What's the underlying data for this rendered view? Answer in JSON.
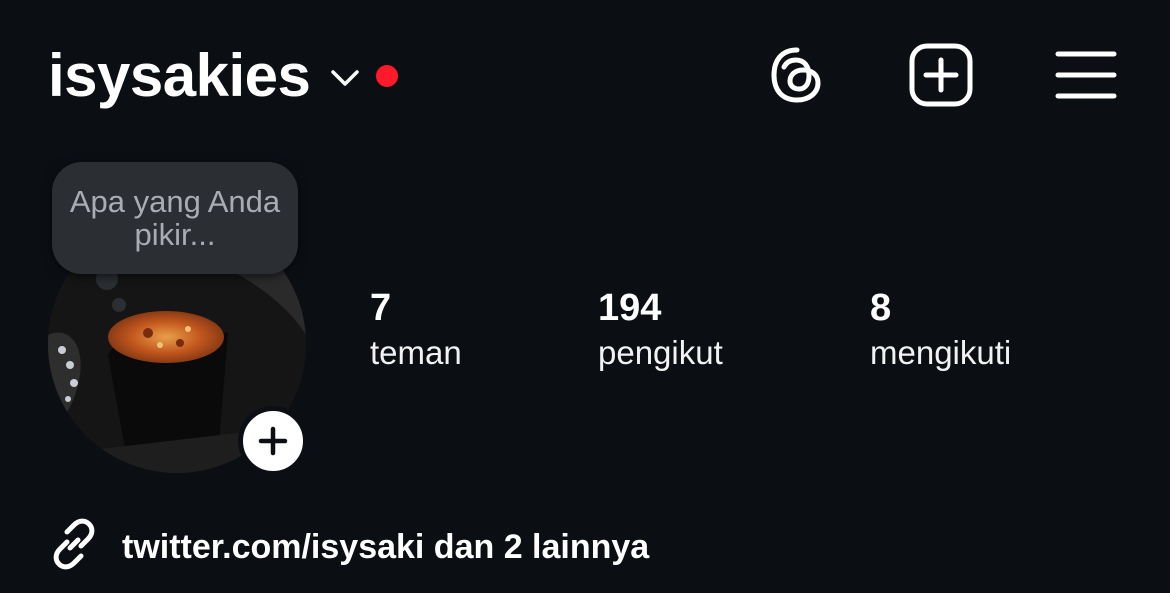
{
  "header": {
    "username": "isysakies",
    "icons": {
      "threads": "threads-icon",
      "create": "add-square-icon",
      "menu": "hamburger-menu-icon"
    },
    "notification_color": "#ff1a2b"
  },
  "note": {
    "placeholder": "Apa yang Anda pikir..."
  },
  "stats": [
    {
      "value": "7",
      "label": "teman"
    },
    {
      "value": "194",
      "label": "pengikut"
    },
    {
      "value": "8",
      "label": "mengikuti"
    }
  ],
  "link": {
    "text": "twitter.com/isysaki dan 2 lainnya",
    "icon": "link-icon"
  },
  "colors": {
    "background": "#0b0f14",
    "text": "#ffffff",
    "note_bubble": "#2b2e33"
  }
}
